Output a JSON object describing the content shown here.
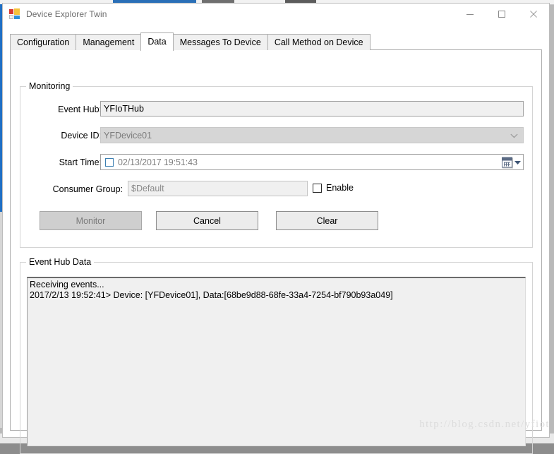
{
  "window": {
    "title": "Device Explorer Twin",
    "icon": "app-icon",
    "controls": {
      "minimize": "minimize-icon",
      "maximize": "maximize-icon",
      "close": "close-icon"
    }
  },
  "tabs": [
    {
      "label": "Configuration",
      "selected": false
    },
    {
      "label": "Management",
      "selected": false
    },
    {
      "label": "Data",
      "selected": true
    },
    {
      "label": "Messages To Device",
      "selected": false
    },
    {
      "label": "Call Method on Device",
      "selected": false
    }
  ],
  "monitoring": {
    "legend": "Monitoring",
    "event_hub": {
      "label": "Event Hub:",
      "value": "YFIoTHub",
      "placeholder": ""
    },
    "device_id": {
      "label": "Device ID:",
      "value": "YFDevice01",
      "enabled": false,
      "arrow_icon": "chevron-down-icon"
    },
    "start_time": {
      "label": "Start Time:",
      "value": "02/13/2017 19:51:43",
      "checked": false,
      "calendar_icon": "calendar-icon",
      "dropdown_icon": "chevron-down-icon"
    },
    "consumer_group": {
      "label": "Consumer Group:",
      "value": "$Default",
      "enabled": false
    },
    "enable_checkbox": {
      "label": "Enable",
      "checked": false
    },
    "buttons": {
      "monitor": {
        "label": "Monitor",
        "enabled": false
      },
      "cancel": {
        "label": "Cancel",
        "enabled": true
      },
      "clear": {
        "label": "Clear",
        "enabled": true
      }
    }
  },
  "event_hub_data": {
    "legend": "Event Hub Data",
    "lines": [
      "Receiving events...",
      "2017/2/13 19:52:41> Device: [YFDevice01], Data:[68be9d88-68fe-33a4-7254-bf790b93a049]"
    ]
  },
  "watermark": "http://blog.csdn.net/yfiot",
  "colors": {
    "window_bg": "#ffffff",
    "control_face": "#f0f0f0",
    "disabled_face": "#d6d6d6",
    "button_face": "#ececec",
    "accent_check": "#3c7fb1",
    "text": "#000000",
    "disabled_text": "#8a8a8a"
  }
}
